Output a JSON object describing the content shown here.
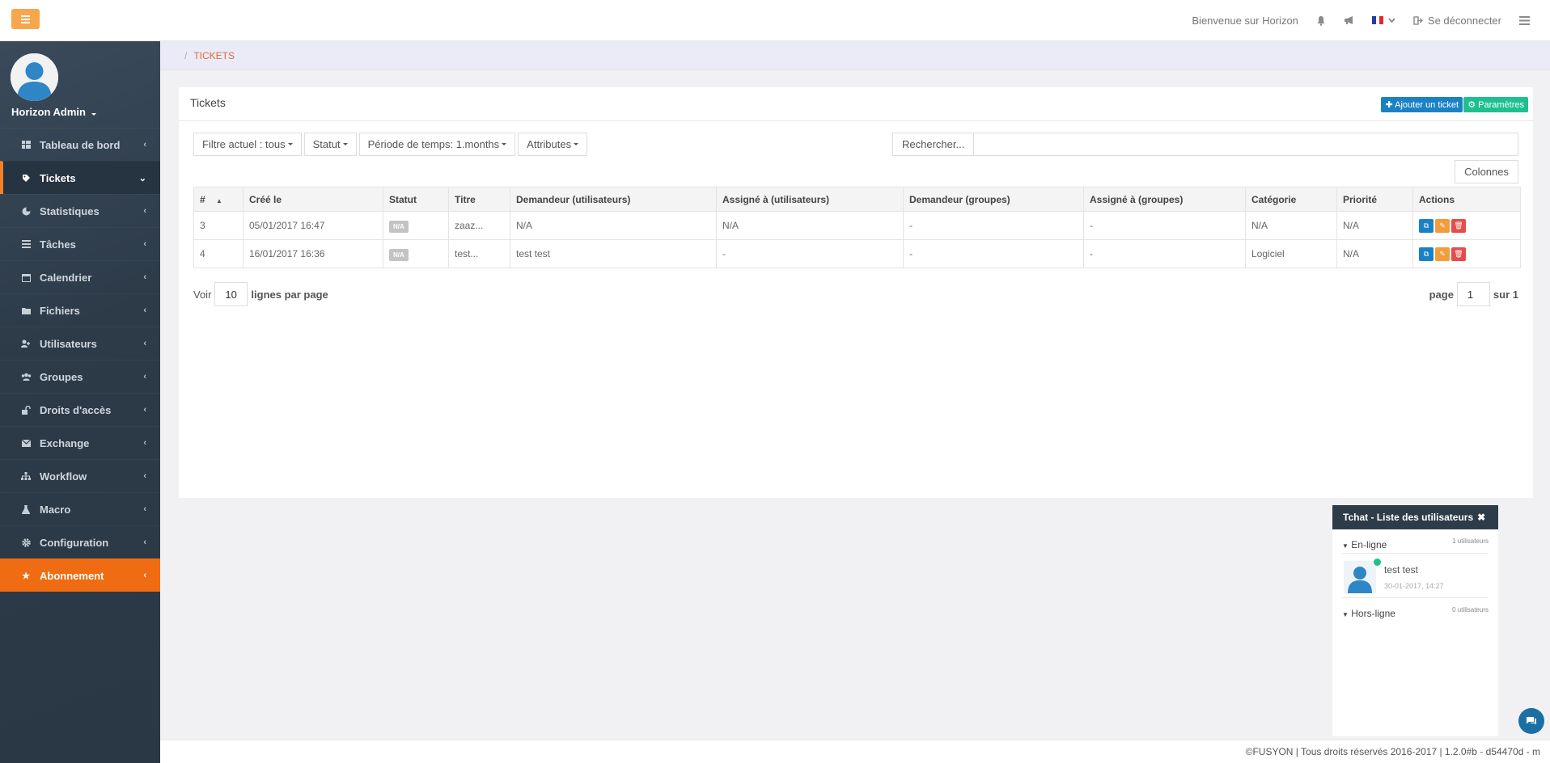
{
  "topbar": {
    "welcome": "Bienvenue sur Horizon",
    "logout": "Se déconnecter",
    "flag_colors": [
      "#1f3fa6",
      "#ffffff",
      "#e3262d"
    ]
  },
  "sidebar": {
    "user_name": "Horizon Admin",
    "items": [
      {
        "label": "Tableau de bord",
        "icon": "dashboard-icon"
      },
      {
        "label": "Tickets",
        "icon": "tag-icon"
      },
      {
        "label": "Statistiques",
        "icon": "pie-chart-icon"
      },
      {
        "label": "Tâches",
        "icon": "tasks-icon"
      },
      {
        "label": "Calendrier",
        "icon": "calendar-icon"
      },
      {
        "label": "Fichiers",
        "icon": "folder-icon"
      },
      {
        "label": "Utilisateurs",
        "icon": "user-plus-icon"
      },
      {
        "label": "Groupes",
        "icon": "users-icon"
      },
      {
        "label": "Droits d'accès",
        "icon": "unlock-icon"
      },
      {
        "label": "Exchange",
        "icon": "envelope-icon"
      },
      {
        "label": "Workflow",
        "icon": "sitemap-icon"
      },
      {
        "label": "Macro",
        "icon": "flask-icon"
      },
      {
        "label": "Configuration",
        "icon": "gear-icon"
      },
      {
        "label": "Abonnement",
        "icon": "star-icon"
      }
    ]
  },
  "breadcrumb": {
    "current": "TICKETS"
  },
  "panel": {
    "title": "Tickets",
    "add_ticket": "Ajouter un ticket",
    "params": "Paramètres"
  },
  "filters": {
    "current": "Filtre actuel : tous",
    "status": "Statut",
    "period": "Période de temps: 1.months",
    "attributes": "Attributes",
    "search_label": "Rechercher...",
    "columns": "Colonnes"
  },
  "table": {
    "headers": [
      "#",
      "Créé le",
      "Statut",
      "Titre",
      "Demandeur (utilisateurs)",
      "Assigné à (utilisateurs)",
      "Demandeur (groupes)",
      "Assigné à (groupes)",
      "Catégorie",
      "Priorité",
      "Actions"
    ],
    "rows": [
      {
        "id": "3",
        "created": "05/01/2017 16:47",
        "status": "N/A",
        "title": "zaaz...",
        "req_user": "N/A",
        "assign_user": "N/A",
        "req_group": "-",
        "assign_group": "-",
        "category": "N/A",
        "priority": "N/A"
      },
      {
        "id": "4",
        "created": "16/01/2017 16:36",
        "status": "N/A",
        "title": "test...",
        "req_user": "test test",
        "assign_user": "-",
        "req_group": "-",
        "assign_group": "-",
        "category": "Logiciel",
        "priority": "N/A"
      }
    ]
  },
  "pager": {
    "show": "Voir",
    "per_page_value": "10",
    "per_page_label": "lignes par page",
    "page_label": "page",
    "page_value": "1",
    "of_label": "sur 1"
  },
  "chat": {
    "title": "Tchat - Liste des utilisateurs",
    "online_label": "En-ligne",
    "online_count": "1 utilisateurs",
    "user_name": "test test",
    "user_time": "30-01-2017, 14:27",
    "offline_label": "Hors-ligne",
    "offline_count": "0 utilisateurs"
  },
  "footer": {
    "text": "©FUSYON | Tous droits réservés 2016-2017 | 1.2.0#b - d54470d - m"
  }
}
